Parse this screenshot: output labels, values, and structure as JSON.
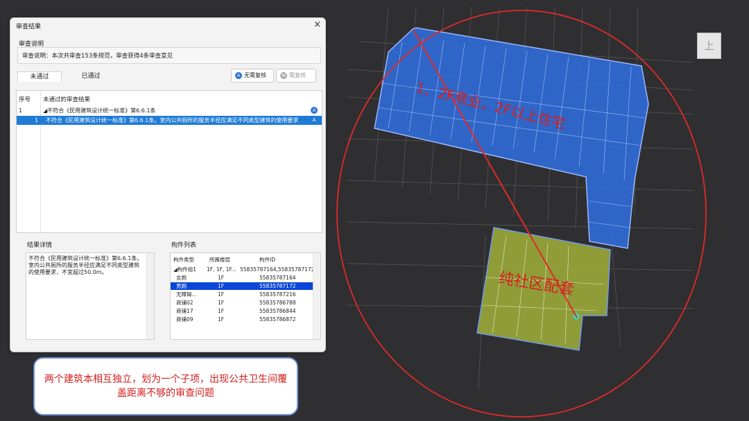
{
  "dialog": {
    "title": "审查结果",
    "close": "×",
    "desc_label": "审查说明",
    "desc_text": "审查说明：本次共审查153条规范，审查获得4条审查意见",
    "tabs": [
      "未通过",
      "已通过"
    ],
    "btn_no_recheck": "无需复核",
    "btn_recheck": "需复核",
    "table": {
      "headers": [
        "序号",
        "未通过的审查结果"
      ],
      "rows": [
        {
          "no": "1",
          "text": "◢不符合《民用建筑设计统一标准》第6.6.1条",
          "badge": "A"
        },
        {
          "no": "1",
          "text": "不符合《民用建筑设计统一标准》第6.6.1条。室内公共厕所的服务半径应满足不同类型建筑的使用要求",
          "badge": "A"
        }
      ]
    },
    "detail_label": "结果详情",
    "detail_text": "不符合《民用建筑设计统一标准》第6.6.1条。室内公共厕所的服务半径应满足不同类型建筑的使用要求，不宜超过50.0m。",
    "components_label": "构件列表",
    "components": {
      "headers": [
        "构件类型",
        "所属楼层",
        "构件ID"
      ],
      "rows": [
        [
          "◢构件组1",
          "1F, 1F, 1F...",
          "55835787164,55835787172,5..."
        ],
        [
          "女厕",
          "1F",
          "55835787164"
        ],
        [
          "男厕",
          "1F",
          "55835787172"
        ],
        [
          "无障碍...",
          "1F",
          "55835787216"
        ],
        [
          "商铺02",
          "1F",
          "55835786788"
        ],
        [
          "商铺17",
          "1F",
          "55835786844"
        ],
        [
          "商铺09",
          "1F",
          "55835786872"
        ]
      ]
    }
  },
  "note": "两个建筑本相互独立，划为一个子项，出现公共卫生间覆盖距离不够的审查问题",
  "labels": {
    "upper": "1、2F商业，2F以上住宅",
    "lower": "纯社区配套"
  },
  "view_cube": "上",
  "colors": {
    "accent_blue": "#1e7bd6",
    "highlight_red": "#d8201f",
    "building_blue": "#2f6fe0",
    "building_green": "#9aa83a"
  }
}
